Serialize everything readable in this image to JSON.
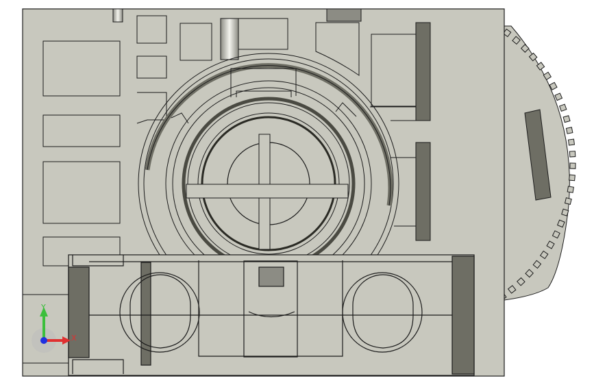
{
  "viewport": {
    "background_color": "#ffffff",
    "part_face_color": "#c8c8be",
    "part_shadow_color": "#6e6e64",
    "edge_color": "#1a1a1a"
  },
  "triad": {
    "y_label": "Y",
    "x_label": "X",
    "y_color": "#3cbf3c",
    "x_color": "#e03030",
    "origin_color": "#2030e0"
  }
}
